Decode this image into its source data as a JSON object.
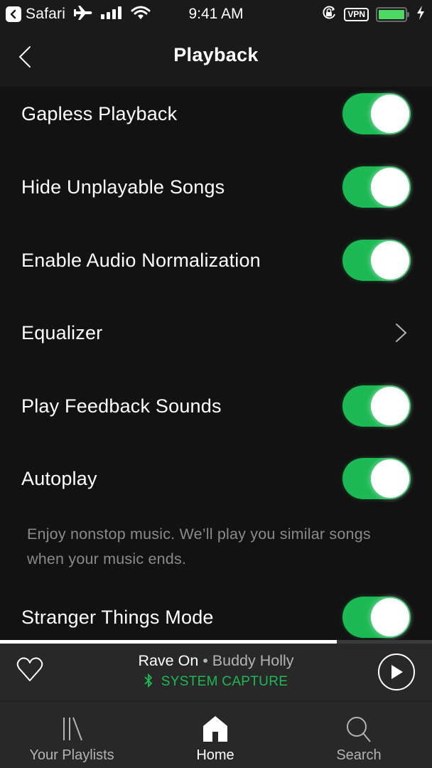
{
  "status_bar": {
    "back_app": "Safari",
    "time": "9:41 AM",
    "vpn": "VPN",
    "battery_percent": 100,
    "icons": [
      "back-app-icon",
      "airplane-icon",
      "signal-icon",
      "wifi-icon",
      "orientation-lock-icon",
      "vpn-badge",
      "battery-icon",
      "charging-icon"
    ]
  },
  "header": {
    "title": "Playback",
    "back_icon": "chevron-left-icon"
  },
  "settings": [
    {
      "label": "Gapless Playback",
      "type": "toggle",
      "on": true
    },
    {
      "label": "Hide Unplayable Songs",
      "type": "toggle",
      "on": true
    },
    {
      "label": "Enable Audio Normalization",
      "type": "toggle",
      "on": true
    },
    {
      "label": "Equalizer",
      "type": "link"
    },
    {
      "label": "Play Feedback Sounds",
      "type": "toggle",
      "on": true
    },
    {
      "label": "Autoplay",
      "type": "toggle",
      "on": true,
      "description": "Enjoy nonstop music. We’ll play you similar songs when your music ends."
    },
    {
      "label": "Stranger Things Mode",
      "type": "toggle",
      "on": true
    }
  ],
  "player": {
    "progress_percent": 78,
    "title": "Rave On",
    "separator": " • ",
    "artist": "Buddy Holly",
    "device": "SYSTEM CAPTURE",
    "device_icon": "bluetooth-icon",
    "like_icon": "heart-outline-icon",
    "play_icon": "play-icon"
  },
  "tabs": [
    {
      "label": "Your Playlists",
      "icon": "library-icon",
      "active": false
    },
    {
      "label": "Home",
      "icon": "home-icon",
      "active": true
    },
    {
      "label": "Search",
      "icon": "search-icon",
      "active": false
    }
  ],
  "colors": {
    "accent": "#1db954",
    "background": "#121212",
    "header": "#1a1a1a",
    "player": "#282828",
    "battery": "#4cd964"
  }
}
